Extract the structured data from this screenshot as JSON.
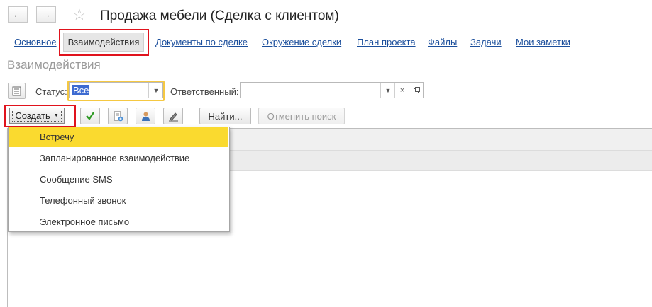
{
  "window": {
    "title": "Продажа мебели (Сделка с клиентом)"
  },
  "nav": {
    "back_icon": "arrow-left-icon",
    "forward_icon": "arrow-right-icon",
    "favorite_icon": "star-icon"
  },
  "tabs": [
    {
      "label": "Основное"
    },
    {
      "label": "Взаимодействия",
      "active": true
    },
    {
      "label": "Документы по сделке"
    },
    {
      "label": "Окружение сделки"
    },
    {
      "label": "План проекта"
    },
    {
      "label": "Файлы"
    },
    {
      "label": "Задачи"
    },
    {
      "label": "Мои заметки"
    }
  ],
  "section": {
    "title": "Взаимодействия"
  },
  "filters": {
    "status_label": "Статус:",
    "status_value": "Все",
    "responsible_label": "Ответственный:",
    "responsible_value": ""
  },
  "toolbar": {
    "create_label": "Создать",
    "find_label": "Найти...",
    "cancel_search_label": "Отменить поиск"
  },
  "create_menu": {
    "items": [
      {
        "label": "Встречу",
        "highlighted": true
      },
      {
        "label": "Запланированное взаимодействие"
      },
      {
        "label": "Сообщение SMS"
      },
      {
        "label": "Телефонный звонок"
      },
      {
        "label": "Электронное письмо"
      }
    ]
  },
  "colors": {
    "link": "#1c4f9c",
    "highlight_red": "#e0131d",
    "menu_active": "#fada2f",
    "focus_yellow": "#f5c842",
    "selection": "#3d6bd1"
  }
}
